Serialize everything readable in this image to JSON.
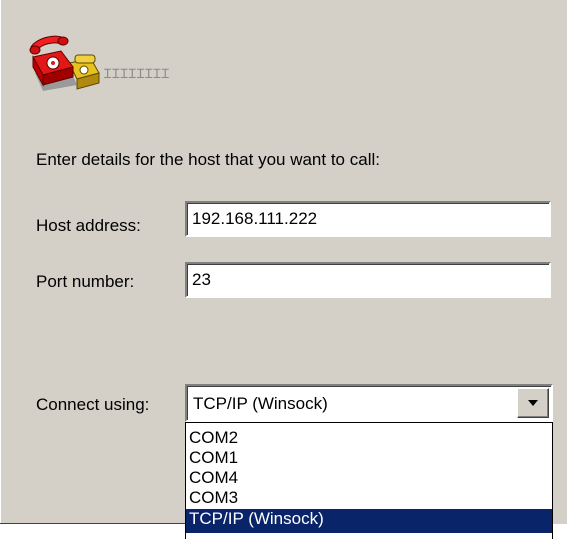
{
  "connection": {
    "name": "ꞮꞮꞮꞮꞮꞮꞮꞮ",
    "icon": "telephone-icon"
  },
  "form": {
    "prompt": "Enter details for the host that you want to call:",
    "host_address": {
      "label": "Host address:",
      "value": "192.168.111.222"
    },
    "port_number": {
      "label": "Port number:",
      "value": "23"
    },
    "connect_using": {
      "label": "Connect using:",
      "selected": "TCP/IP (Winsock)",
      "options": [
        "COM2",
        "COM1",
        "COM4",
        "COM3",
        "TCP/IP (Winsock)"
      ],
      "highlighted_index": 4
    }
  },
  "colors": {
    "dialog_background": "#d4d0c8",
    "selection_highlight": "#0a246a",
    "selection_text": "#ffffff"
  }
}
